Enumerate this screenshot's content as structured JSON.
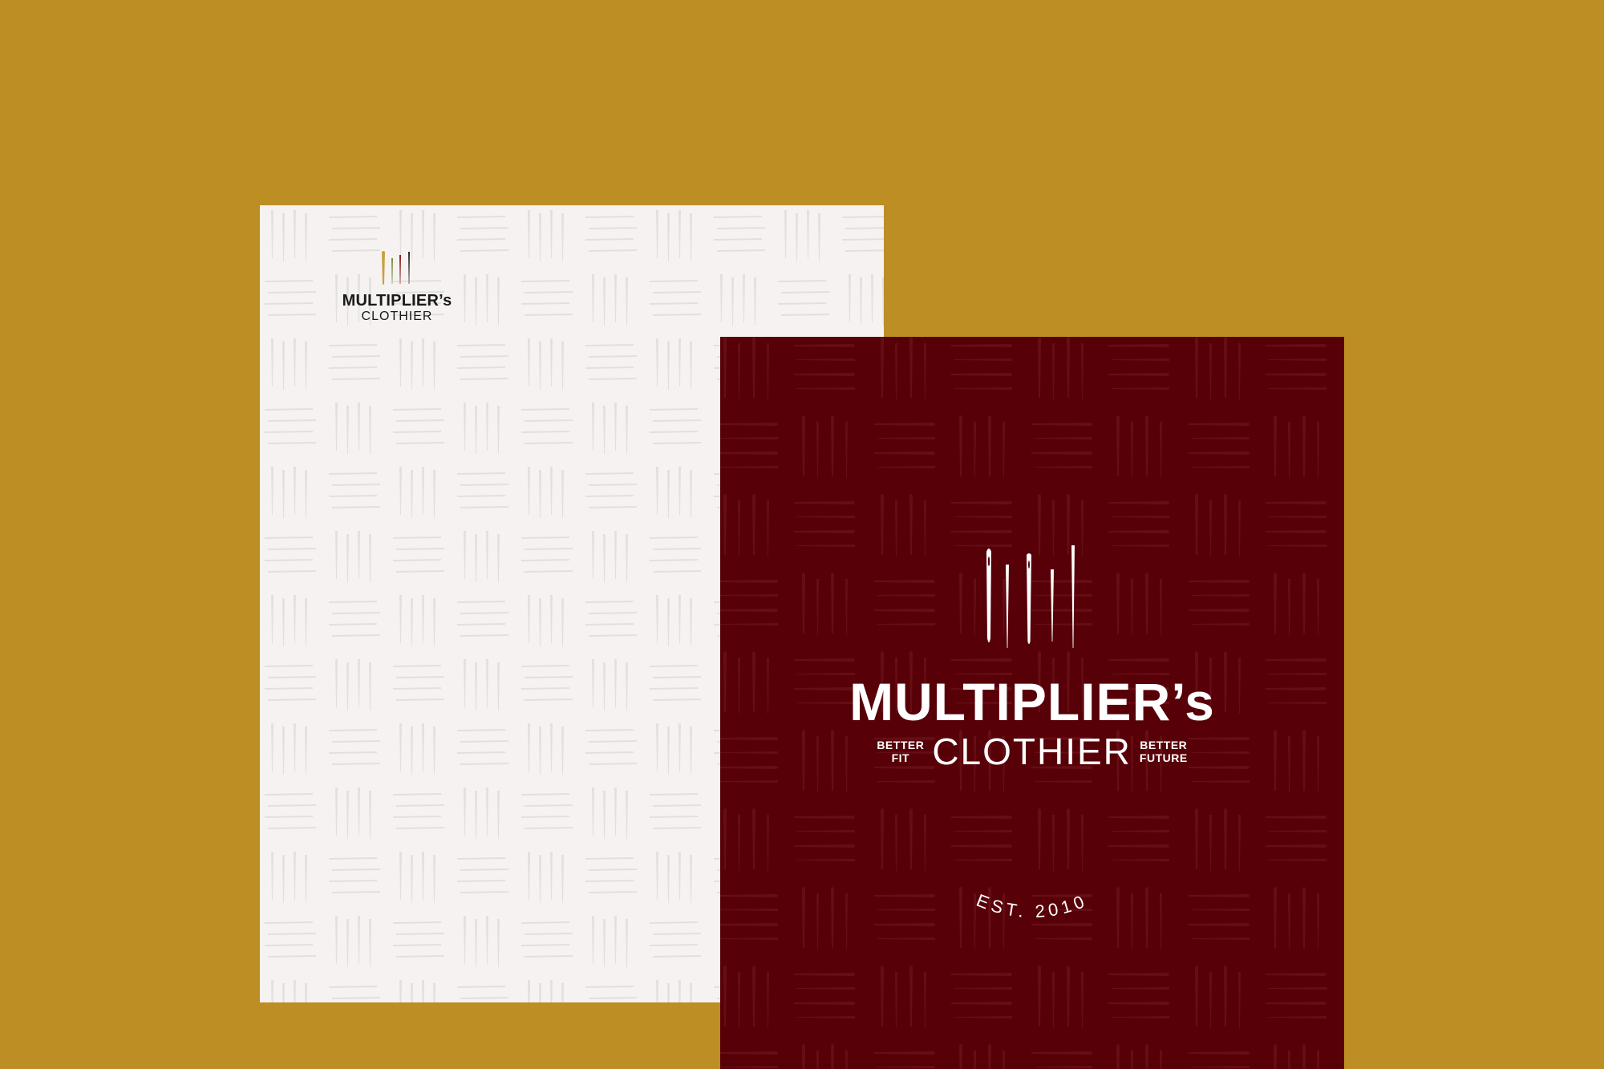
{
  "colors": {
    "background": "#bd8e24",
    "letterhead_paper": "#f5f2f1",
    "cover_paper": "#570008",
    "needle_gold": "#c9a03a",
    "needle_green": "#7f8a3a",
    "needle_red": "#8a1a1a",
    "needle_dark": "#2a2a2a"
  },
  "letterhead": {
    "brand": "MULTIPLIER’s",
    "sub": "CLOTHIER",
    "icon": "needles-icon"
  },
  "cover": {
    "brand": "MULTIPLIER’s",
    "sub": "CLOTHIER",
    "tag_left_1": "BETTER",
    "tag_left_2": "FIT",
    "tag_right_1": "BETTER",
    "tag_right_2": "FUTURE",
    "est": "EST. 2010",
    "icon": "needles-icon"
  }
}
